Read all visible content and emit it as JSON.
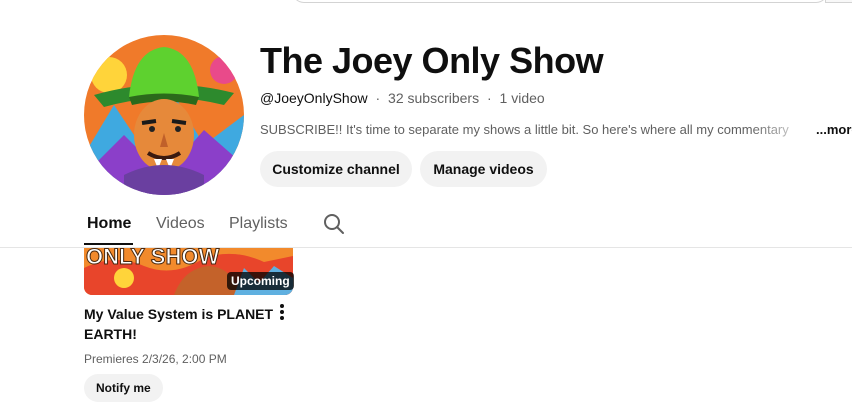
{
  "channel": {
    "name": "The Joey Only Show",
    "handle": "@JoeyOnlyShow",
    "subscribers": "32 subscribers",
    "videos": "1 video",
    "separator": "·",
    "description": "SUBSCRIBE!! It's time to separate my shows a little bit. So here's where all my commentary",
    "more_label": "...more"
  },
  "actions": {
    "customize_label": "Customize channel",
    "manage_label": "Manage videos"
  },
  "tabs": [
    {
      "label": "Home",
      "active": true
    },
    {
      "label": "Videos",
      "active": false
    },
    {
      "label": "Playlists",
      "active": false
    }
  ],
  "video": {
    "badge": "Upcoming",
    "title": "My Value System is PLANET EARTH!",
    "premiere": "Premieres 2/3/26, 2:00 PM",
    "notify_label": "Notify me",
    "thumb_text": "ONLY SHOW"
  },
  "icons": {
    "search_tab": "search-icon",
    "menu": "more-vert-icon"
  },
  "colors": {
    "text_primary": "#0f0f0f",
    "text_secondary": "#606060",
    "pill_bg": "#f2f2f2"
  }
}
